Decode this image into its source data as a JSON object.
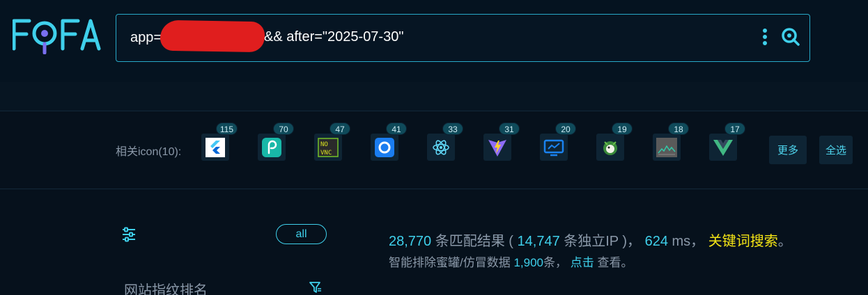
{
  "logo": {
    "text": "FOFA",
    "color": "#3fd0eb"
  },
  "search": {
    "prefix": "app=",
    "suffix": "&& after=\"2025-07-30\"",
    "more_icon": "vertical-dots-icon",
    "search_icon": "search-icon"
  },
  "icons": {
    "label": "相关icon(10):",
    "items": [
      {
        "name": "flutter-icon",
        "count": "115"
      },
      {
        "name": "spiral-p-icon",
        "count": "70"
      },
      {
        "name": "novnc-icon",
        "count": "47"
      },
      {
        "name": "ring-icon",
        "count": "41"
      },
      {
        "name": "react-icon",
        "count": "33"
      },
      {
        "name": "vite-icon",
        "count": "31"
      },
      {
        "name": "monitor-chart-icon",
        "count": "20"
      },
      {
        "name": "mascot-icon",
        "count": "19"
      },
      {
        "name": "grafana-graph-icon",
        "count": "18"
      },
      {
        "name": "vue-icon",
        "count": "17"
      }
    ],
    "more_label": "更多",
    "select_all_label": "全选"
  },
  "sidebar": {
    "all_label": "all",
    "rank_title": "网站指纹排名"
  },
  "results": {
    "total": "28,770",
    "total_text": "条匹配结果 (",
    "unique_ip": "14,747",
    "unique_text": "条独立IP )，",
    "ms": "624",
    "ms_text": "ms，",
    "keyword_link": "关键词搜索",
    "period": "。",
    "filtered_prefix": "智能排除蜜罐/仿冒数据",
    "filtered_count": "1,900",
    "filtered_mid": "条，",
    "click_link": "点击",
    "filtered_suffix": "查看。"
  }
}
